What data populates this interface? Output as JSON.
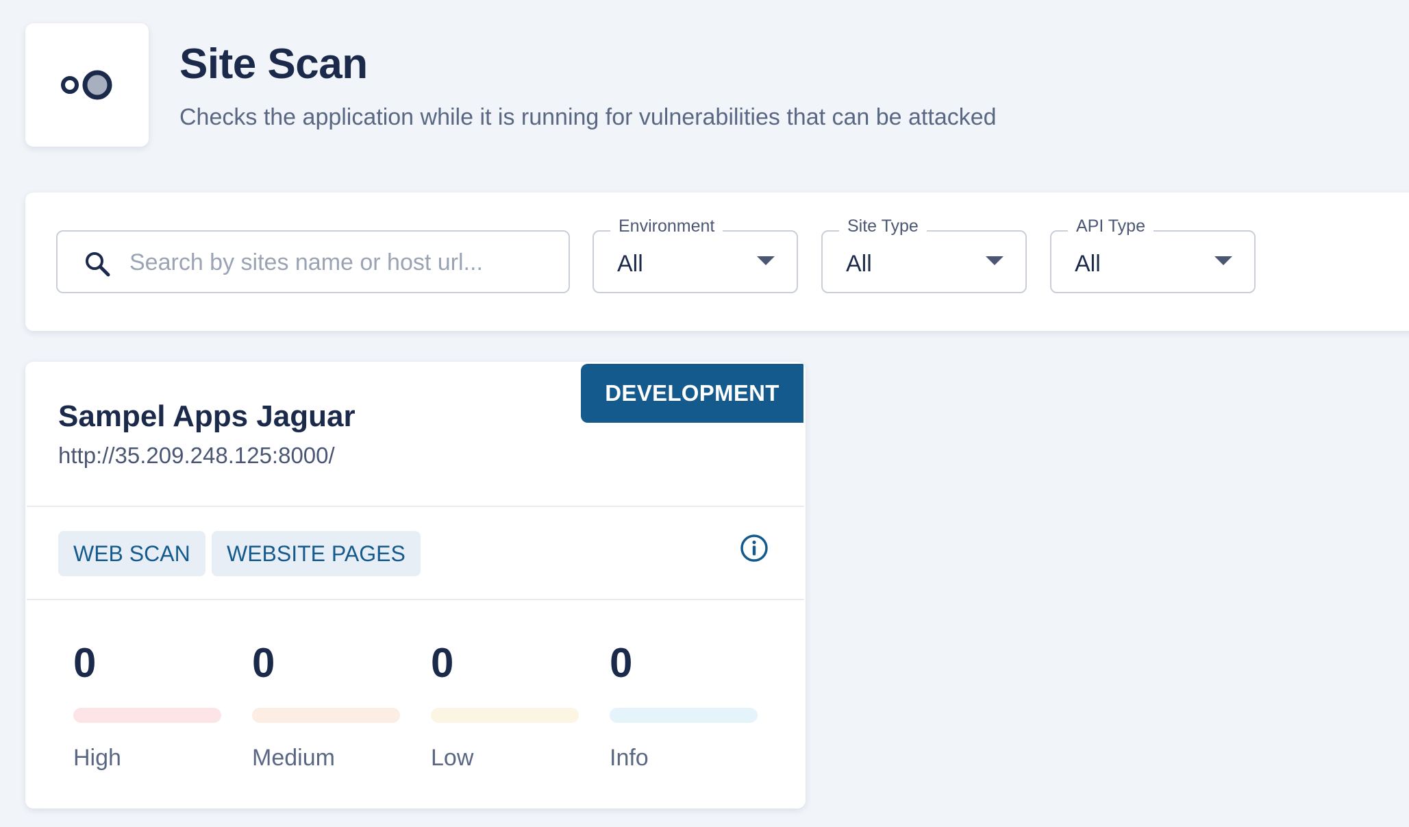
{
  "header": {
    "logo_icon": "scan-logo-icon",
    "title": "Site Scan",
    "subtitle": "Checks the application while it is running for vulnerabilities that can be attacked"
  },
  "filters": {
    "search": {
      "icon": "search-icon",
      "placeholder": "Search by sites name or host url..."
    },
    "environment": {
      "label": "Environment",
      "value": "All"
    },
    "site_type": {
      "label": "Site Type",
      "value": "All"
    },
    "api_type": {
      "label": "API Type",
      "value": "All"
    }
  },
  "site_card": {
    "environment_badge": "DEVELOPMENT",
    "name": "Sampel Apps Jaguar",
    "url": "http://35.209.248.125:8000/",
    "chips": [
      "WEB SCAN",
      "WEBSITE PAGES"
    ],
    "info_icon": "info-icon",
    "stats": [
      {
        "value": "0",
        "label": "High",
        "color": "#fde4e6"
      },
      {
        "value": "0",
        "label": "Medium",
        "color": "#fdeee5"
      },
      {
        "value": "0",
        "label": "Low",
        "color": "#fdf5e3"
      },
      {
        "value": "0",
        "label": "Info",
        "color": "#e5f3fb"
      }
    ]
  },
  "colors": {
    "background": "#f1f4f9",
    "primary": "#145a8c",
    "text_dark": "#1b2a4a",
    "text_muted": "#5a6782"
  }
}
